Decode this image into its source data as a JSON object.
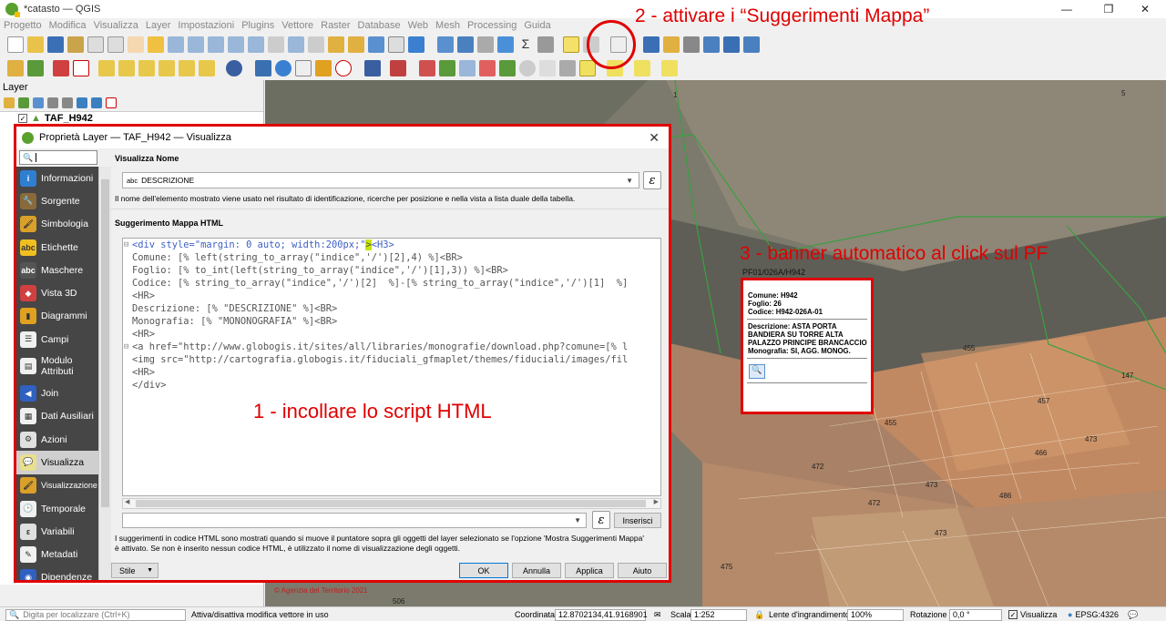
{
  "window": {
    "title": "*catasto — QGIS",
    "minimize": "—",
    "maximize": "❐",
    "close": "✕"
  },
  "menu": [
    "Progetto",
    "Modifica",
    "Visualizza",
    "Layer",
    "Impostazioni",
    "Plugins",
    "Vettore",
    "Raster",
    "Database",
    "Web",
    "Mesh",
    "Processing",
    "Guida"
  ],
  "layers_panel": {
    "title": "Layer",
    "layer_name": "TAF_H942"
  },
  "annotations": {
    "step1": "1 - incollare lo script HTML",
    "step2": "2 - attivare i “Suggerimenti Mappa”",
    "step3": "3 - banner automatico al click sul PF"
  },
  "dialog": {
    "title": "Proprietà Layer — TAF_H942 — Visualizza",
    "close": "✕",
    "search_placeholder": "",
    "sidebar": [
      {
        "label": "Informazioni",
        "icon": "info-icon",
        "color": "#2f7fd1",
        "glyph": "i"
      },
      {
        "label": "Sorgente",
        "icon": "wrench-icon",
        "color": "#8a6a3a",
        "glyph": "🔧"
      },
      {
        "label": "Simbologia",
        "icon": "paint-brush-icon",
        "color": "#d9a02a",
        "glyph": "🖌"
      },
      {
        "label": "Etichette",
        "icon": "label-abc-icon",
        "color": "#f0c020",
        "glyph": "abc"
      },
      {
        "label": "Maschere",
        "icon": "mask-abc-icon",
        "color": "#555555",
        "glyph": "abc"
      },
      {
        "label": "Vista 3D",
        "icon": "cube-icon",
        "color": "#d04040",
        "glyph": "◆"
      },
      {
        "label": "Diagrammi",
        "icon": "chart-icon",
        "color": "#e0a020",
        "glyph": "▮"
      },
      {
        "label": "Campi",
        "icon": "fields-icon",
        "color": "#f0f0f0",
        "glyph": "☰"
      },
      {
        "label": "Modulo Attributi",
        "icon": "form-icon",
        "color": "#f0f0f0",
        "glyph": "▤"
      },
      {
        "label": "Join",
        "icon": "join-icon",
        "color": "#3060c0",
        "glyph": "◀"
      },
      {
        "label": "Dati Ausiliari",
        "icon": "aux-data-icon",
        "color": "#f0f0f0",
        "glyph": "▦"
      },
      {
        "label": "Azioni",
        "icon": "gear-icon",
        "color": "#e0e0e0",
        "glyph": "⚙"
      },
      {
        "label": "Visualizza",
        "icon": "tooltip-icon",
        "color": "#e8e090",
        "glyph": "💬"
      },
      {
        "label": "Visualizzazione",
        "icon": "brush-icon",
        "color": "#d9a02a",
        "glyph": "🖌"
      },
      {
        "label": "Temporale",
        "icon": "clock-icon",
        "color": "#f0f0f0",
        "glyph": "🕒"
      },
      {
        "label": "Variabili",
        "icon": "variables-icon",
        "color": "#e0e0e0",
        "glyph": "ε"
      },
      {
        "label": "Metadati",
        "icon": "metadata-icon",
        "color": "#f0f0f0",
        "glyph": "✎"
      },
      {
        "label": "Dipendenze",
        "icon": "dependencies-icon",
        "color": "#3060c0",
        "glyph": "◉"
      }
    ],
    "display_name_label": "Visualizza Nome",
    "display_name_value": "DESCRIZIONE",
    "display_name_type": "abc",
    "display_name_help": "Il nome dell'elemento mostrato viene usato nel risultato di identificazione, ricerche per posizione e nella vista a lista duale della tabella.",
    "html_tip_label": "Suggerimento Mappa HTML",
    "expression_button": "ε",
    "insert_button": "Inserisci",
    "help_text_1": "I suggerimenti in codice HTML sono mostrati quando si muove il puntatore sopra gli oggetti del layer selezionato se l'opzione 'Mostra Suggerimenti Mappa'",
    "help_text_2": "è attivato. Se non è inserito nessun codice HTML, è utilizzato il nome di visualizzazione degli oggetti.",
    "style_button": "Stile",
    "ok": "OK",
    "cancel": "Annulla",
    "apply": "Applica",
    "help": "Aiuto"
  },
  "code": {
    "l1_a": "<div style=\"margin: 0 auto; width:200px;\"",
    "l1_b": ">",
    "l1_c": "<H3>",
    "l2": "Comune: [% left(string_to_array(\"indice\",'/')[2],4) %]<BR>",
    "l3": "Foglio: [% to_int(left(string_to_array(\"indice\",'/')[1],3)) %]<BR>",
    "l4": "Codice: [% string_to_array(\"indice\",'/')[2]  %]-[% string_to_array(\"indice\",'/')[1]  %]",
    "l5": "<HR>",
    "l6": "Descrizione: [% \"DESCRIZIONE\" %]<BR>",
    "l7": "Monografia: [% \"MONONOGRAFIA\" %]<BR>",
    "l8": "<HR>",
    "l9": "<a href=\"http://www.globogis.it/sites/all/libraries/monografie/download.php?comune=[% l",
    "l10": "<img src=\"http://cartografia.globogis.it/fiduciali_gfmaplet/themes/fiduciali/images/fil",
    "l11": "<HR>",
    "l12": "</div>"
  },
  "popup": {
    "feature_id": "PF01/026A/H942",
    "comune": "Comune: H942",
    "foglio": "Foglio: 26",
    "codice": "Codice: H942-026A-01",
    "descrizione": "Descrizione: ASTA PORTA BANDIERA SU TORRE ALTA PALAZZO PRINCIPE BRANCACCIO",
    "monografia": "Monografia: SI, AGG. MONOG."
  },
  "map_labels": [
    "455",
    "147",
    "457",
    "455",
    "486",
    "473",
    "473",
    "472",
    "466",
    "473",
    "472",
    "506",
    "475",
    "1",
    "5"
  ],
  "map_copyright": "© Agenzia del Territorio 2021",
  "status": {
    "locator_placeholder": "Digita per localizzare (Ctrl+K)",
    "message": "Attiva/disattiva modifica vettore in uso",
    "coord_label": "Coordinata",
    "coord_value": "12.8702134,41.9168901",
    "scale_label": "Scala",
    "scale_value": "1:252",
    "magnifier_label": "Lente d'ingrandimento",
    "magnifier_value": "100%",
    "rotation_label": "Rotazione",
    "rotation_value": "0,0 °",
    "render_label": "Visualizza",
    "crs": "EPSG:4326"
  },
  "colors": {
    "annotation_red": "#e00000",
    "sidebar_bg": "#464646",
    "qgis_green": "#5aa02c"
  }
}
